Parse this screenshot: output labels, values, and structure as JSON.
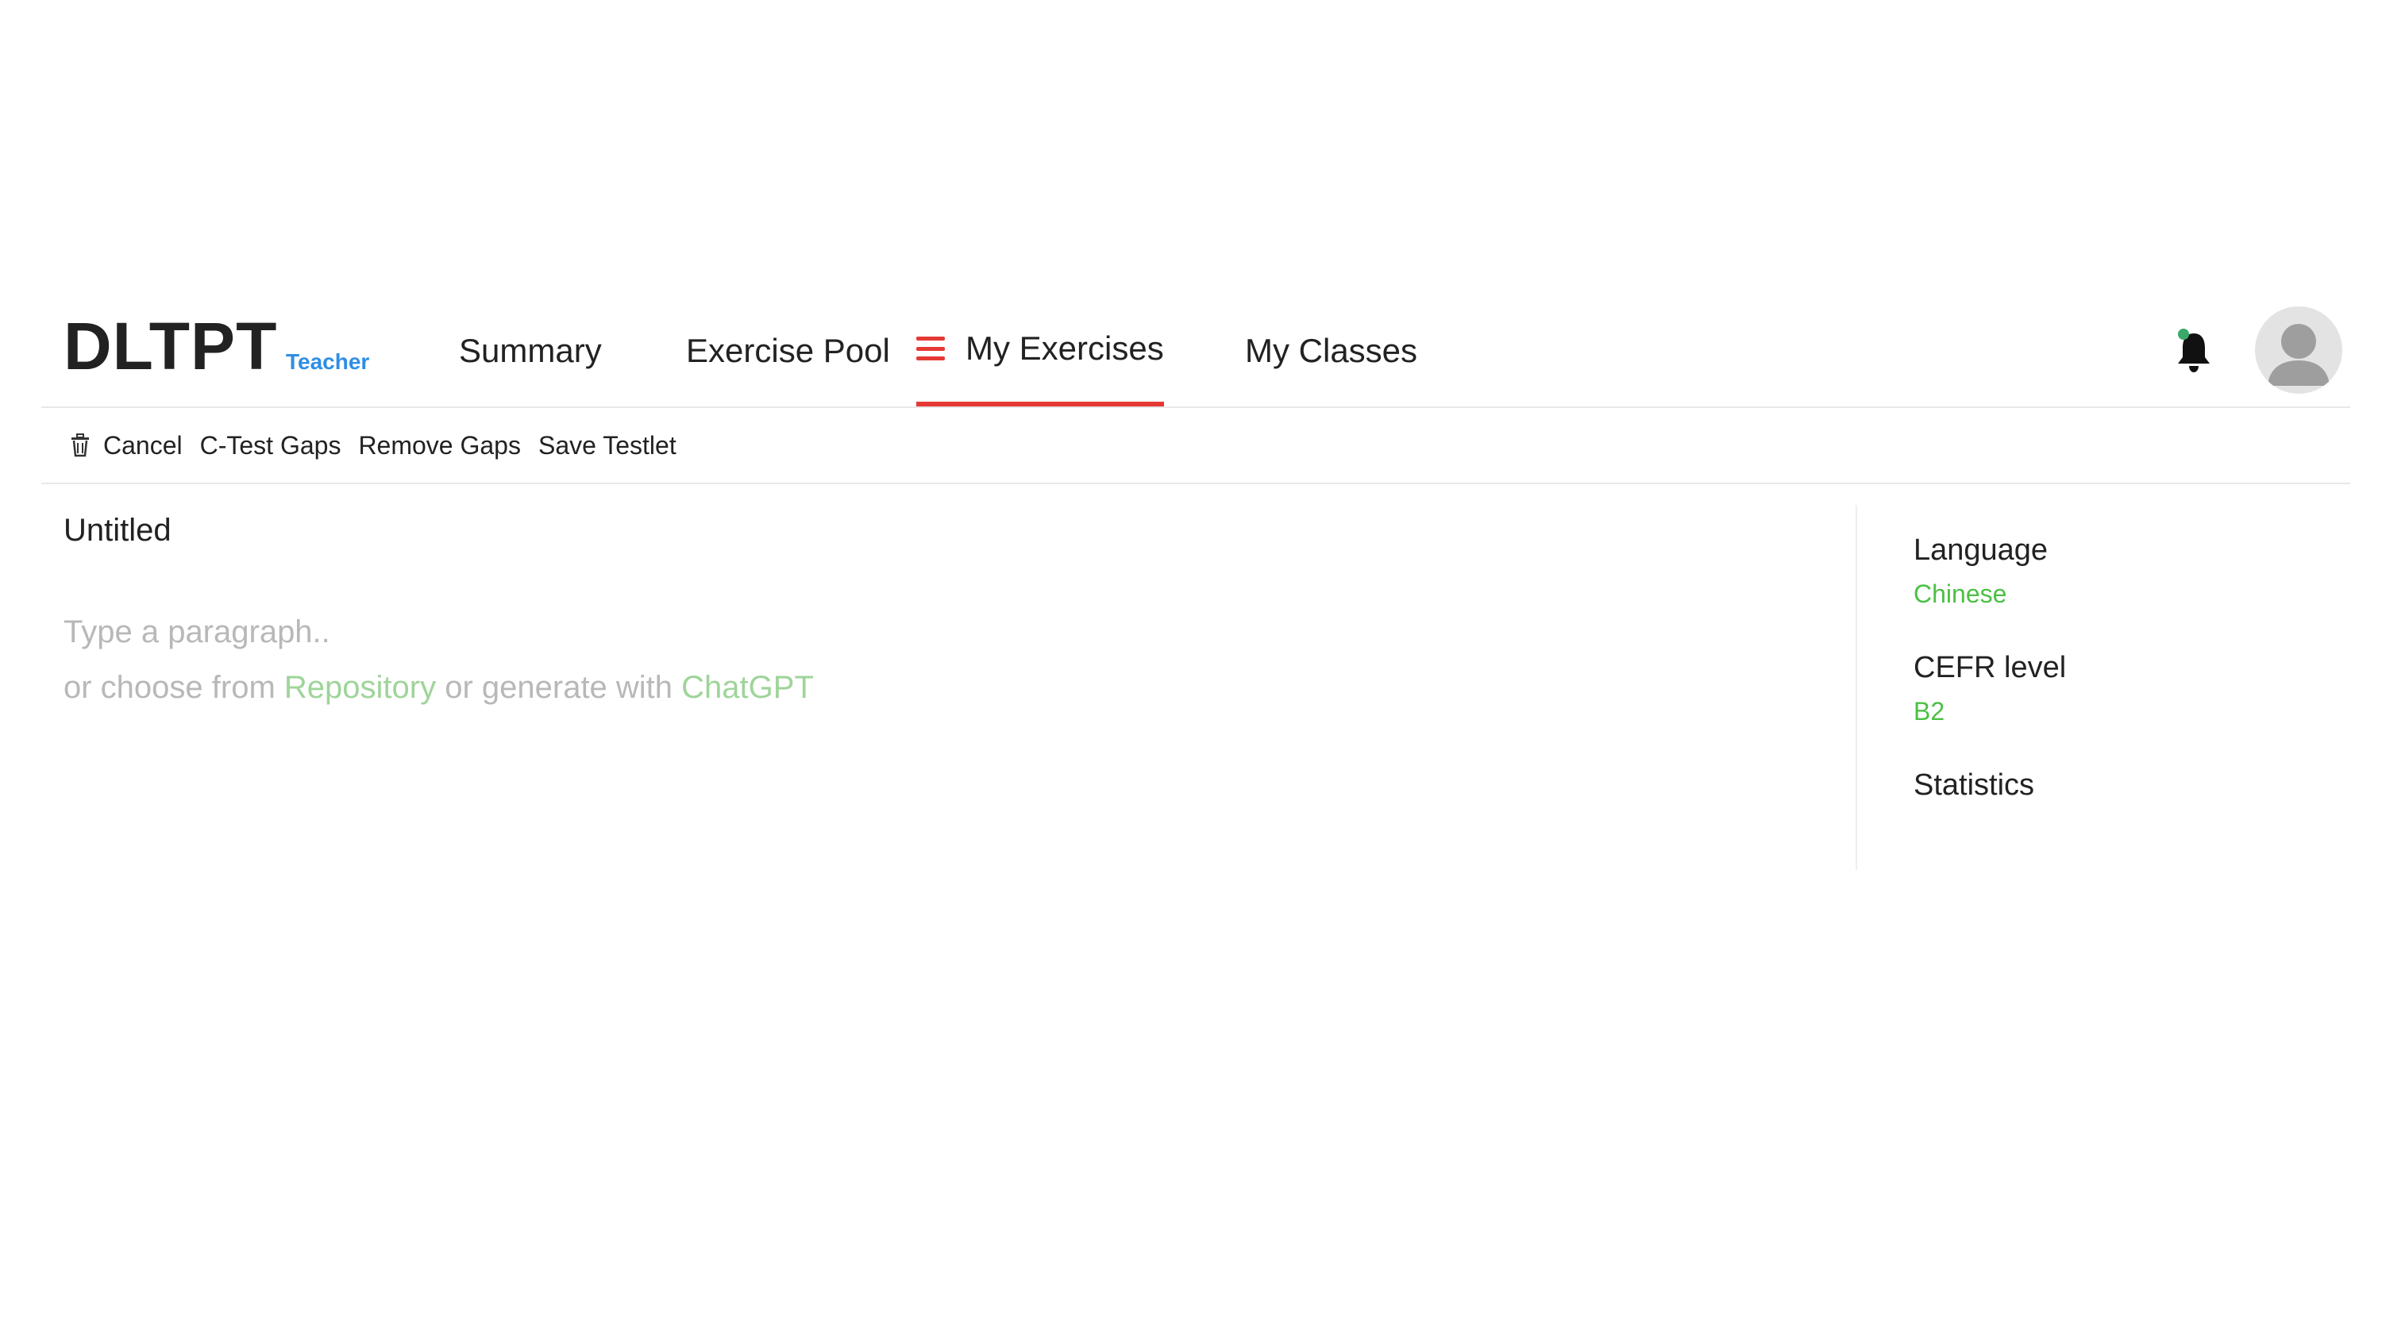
{
  "header": {
    "logo": "DLTPT",
    "role": "Teacher",
    "nav": {
      "summary": "Summary",
      "exercise_pool": "Exercise Pool",
      "my_exercises": "My Exercises",
      "my_classes": "My Classes"
    },
    "active_tab": "My Exercises"
  },
  "toolbar": {
    "cancel": "Cancel",
    "ctest_gaps": "C-Test Gaps",
    "remove_gaps": "Remove Gaps",
    "save_testlet": "Save Testlet"
  },
  "editor": {
    "title": "Untitled",
    "placeholder_line1": "Type a paragraph..",
    "line2_prefix": "or choose from ",
    "repository_link": "Repository",
    "line2_middle": " or generate with ",
    "chatgpt_link": "ChatGPT"
  },
  "sidebar": {
    "language_label": "Language",
    "language_value": "Chinese",
    "cefr_label": "CEFR level",
    "cefr_value": "B2",
    "statistics_label": "Statistics"
  },
  "colors": {
    "accent_red": "#e53935",
    "role_blue": "#2f8ee5",
    "value_green": "#4cc044",
    "link_green": "#9fd49a",
    "notification_dot": "#3aa86b"
  },
  "icons": {
    "menu": "hamburger-menu-icon",
    "bell": "bell-icon",
    "avatar": "user-avatar-icon",
    "trash": "trash-icon"
  }
}
